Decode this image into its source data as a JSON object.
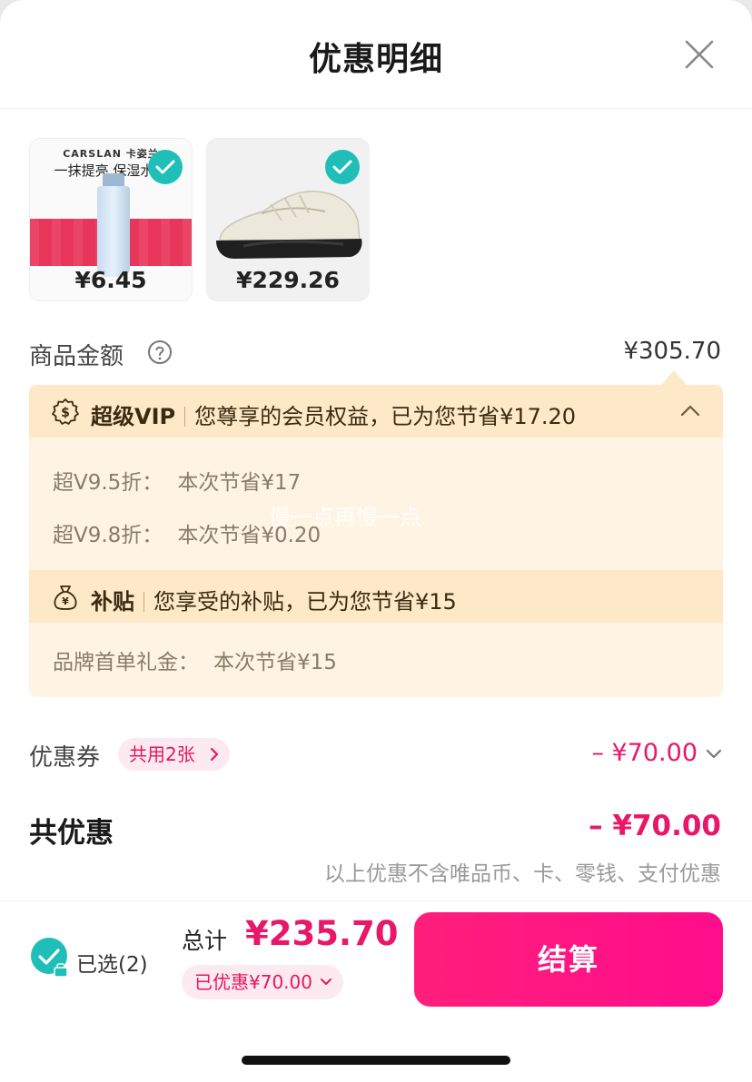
{
  "header": {
    "title": "优惠明细"
  },
  "products": [
    {
      "brand": "CARSLAN 卡姿兰",
      "promo": "一抹提亮 保湿水润",
      "price": "¥6.45",
      "selected": true
    },
    {
      "price": "¥229.26",
      "selected": true
    }
  ],
  "goods_amount": {
    "label": "商品金额",
    "value": "¥305.70"
  },
  "vip": {
    "title": "超级VIP",
    "summary": "您尊享的会员权益，已为您节省¥17.20",
    "items": [
      {
        "label": "超V9.5折：",
        "value": "本次节省¥17"
      },
      {
        "label": "超V9.8折：",
        "value": "本次节省¥0.20"
      }
    ],
    "watermark": "慢一点再慢一点"
  },
  "subsidy": {
    "title": "补贴",
    "summary": "您享受的补贴，已为您节省¥15",
    "items": [
      {
        "label": "品牌首单礼金：",
        "value": "本次节省¥15"
      }
    ]
  },
  "coupon": {
    "label": "优惠券",
    "tag": "共用2张",
    "value": "– ¥70.00"
  },
  "total_discount": {
    "label": "共优惠",
    "value": "– ¥70.00",
    "note": "以上优惠不含唯品币、卡、零钱、支付优惠"
  },
  "footer": {
    "selected_text": "已选(2)",
    "sum_label": "总计",
    "sum_value": "¥235.70",
    "saved_text": "已优惠¥70.00",
    "checkout_label": "结算"
  },
  "colors": {
    "accent": "#e8176a",
    "teal": "#1fbfb8",
    "vip_bg": "#fff4e3",
    "vip_band": "#fde9c8"
  }
}
